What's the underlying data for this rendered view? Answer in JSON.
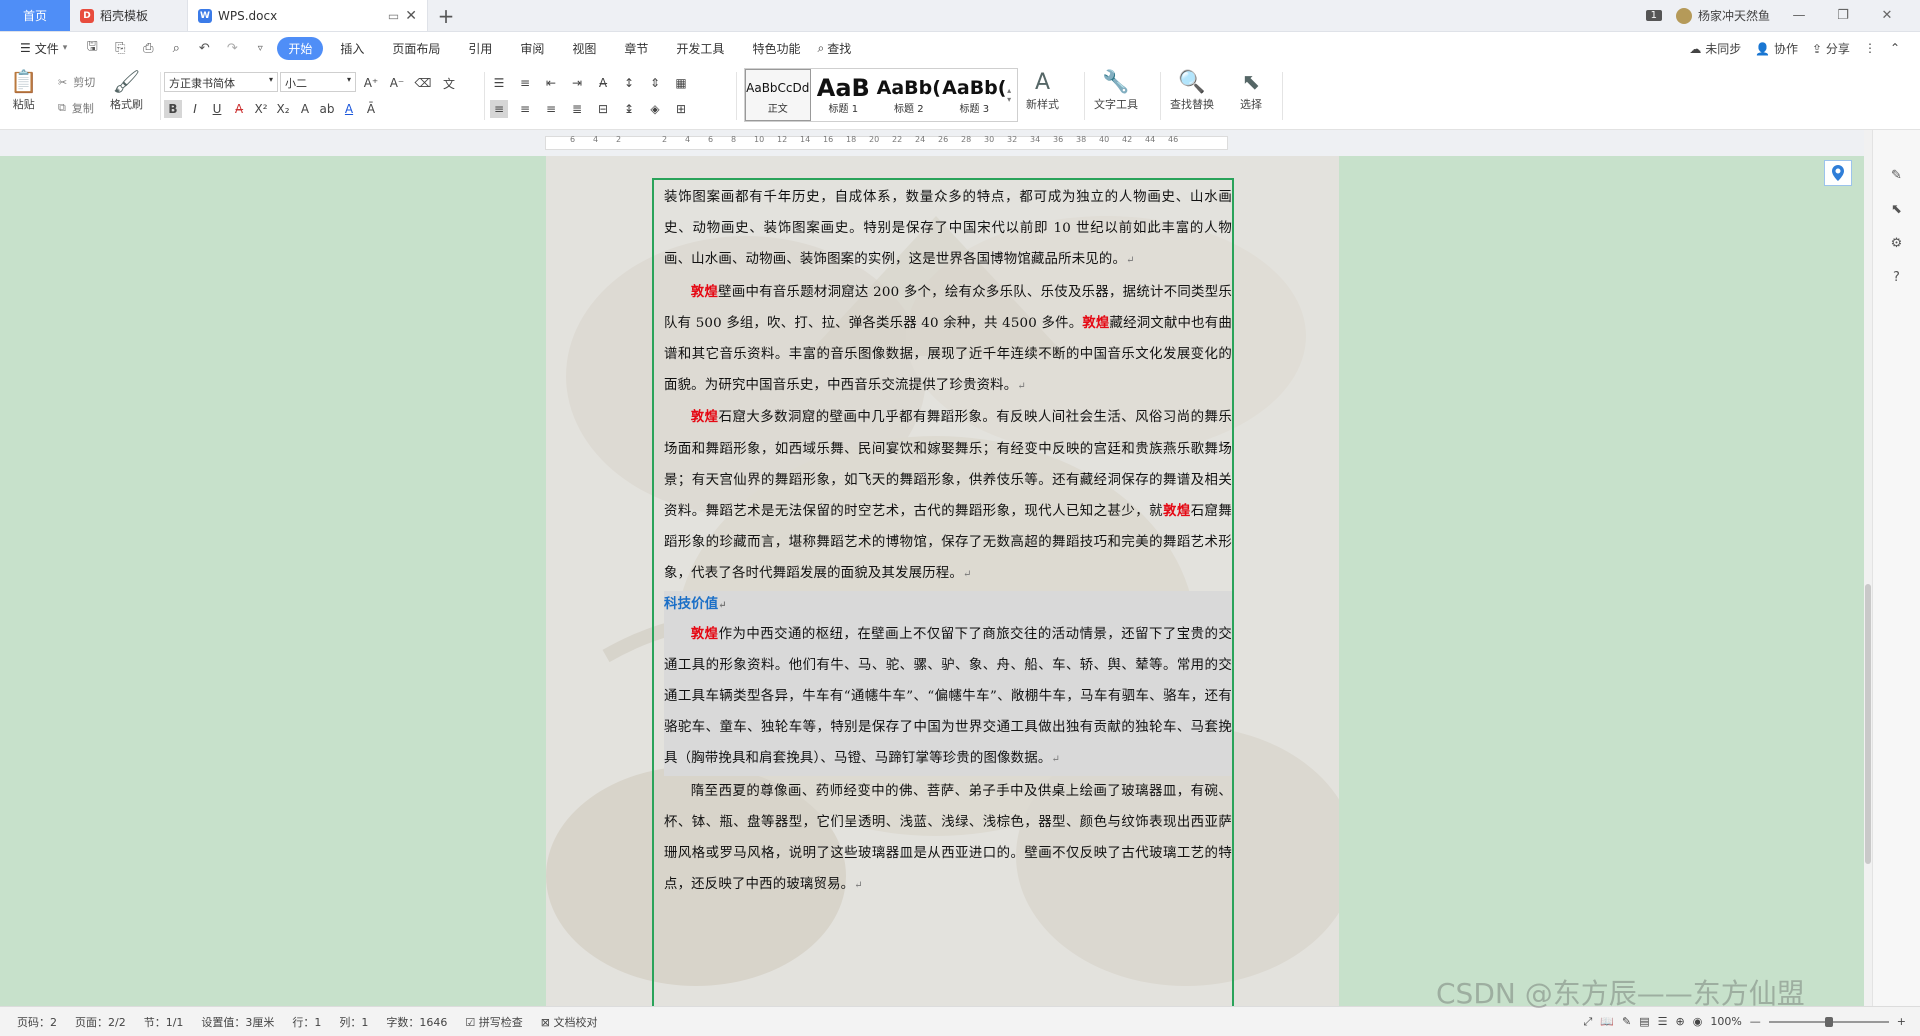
{
  "titlebar": {
    "home_tab": "首页",
    "template_tab": "稻壳模板",
    "doc_tab": "WPS.docx",
    "badge": "1",
    "user": "杨家冲天然鱼"
  },
  "menubar": {
    "file": "文件",
    "tabs": [
      "开始",
      "插入",
      "页面布局",
      "引用",
      "审阅",
      "视图",
      "章节",
      "开发工具",
      "特色功能"
    ],
    "search": "查找",
    "sync": "未同步",
    "collab": "协作",
    "share": "分享"
  },
  "ribbon": {
    "paste": "粘贴",
    "cut": "剪切",
    "copy": "复制",
    "format_painter": "格式刷",
    "font_name": "方正隶书简体",
    "font_size": "小二",
    "styles": [
      {
        "sample": "AaBbCcDd",
        "label": "正文"
      },
      {
        "sample": "AaB",
        "label": "标题 1"
      },
      {
        "sample": "AaBb(",
        "label": "标题 2"
      },
      {
        "sample": "AaBb(",
        "label": "标题 3"
      }
    ],
    "new_style": "新样式",
    "text_tools": "文字工具",
    "find_replace": "查找替换",
    "select": "选择"
  },
  "ruler": {
    "numbers": [
      "6",
      "4",
      "2",
      "",
      "2",
      "4",
      "6",
      "8",
      "10",
      "12",
      "14",
      "16",
      "18",
      "20",
      "22",
      "24",
      "26",
      "28",
      "30",
      "32",
      "34",
      "36",
      "38",
      "40",
      "42",
      "44",
      "46"
    ]
  },
  "document": {
    "p1": "装饰图案画都有千年历史，自成体系，数量众多的特点，都可成为独立的人物画史、山水画史、动物画史、装饰图案画史。特别是保存了中国宋代以前即 10 世纪以前如此丰富的人物画、山水画、动物画、装饰图案的实例，这是世界各国博物馆藏品所未见的。",
    "kw": "敦煌",
    "p2a": "壁画中有音乐题材洞窟达 200 多个，绘有众多乐队、乐伎及乐器，据统计不同类型乐队有 500 多组，吹、打、拉、弹各类乐器 40 余种，共 4500 多件。",
    "p2b": "藏经洞文献中也有曲谱和其它音乐资料。丰富的音乐图像数据，展现了近千年连续不断的中国音乐文化发展变化的面貌。为研究中国音乐史，中西音乐交流提供了珍贵资料。",
    "p3a": "石窟大多数洞窟的壁画中几乎都有舞蹈形象。有反映人间社会生活、风俗习尚的舞乐场面和舞蹈形象，如西域乐舞、民间宴饮和嫁娶舞乐；有经变中反映的宫廷和贵族燕乐歌舞场景；有天宫仙界的舞蹈形象，如飞天的舞蹈形象，供养伎乐等。还有藏经洞保存的舞谱及相关资料。舞蹈艺术是无法保留的时空艺术，古代的舞蹈形象，现代人已知之甚少，就",
    "p3b": "石窟舞蹈形象的珍藏而言，堪称舞蹈艺术的博物馆，保存了无数高超的舞蹈技巧和完美的舞蹈艺术形象，代表了各时代舞蹈发展的面貌及其发展历程。",
    "heading": "科技价值",
    "p4": "作为中西交通的枢纽，在壁画上不仅留下了商旅交往的活动情景，还留下了宝贵的交通工具的形象资料。他们有牛、马、驼、骡、驴、象、舟、船、车、轿、舆、辇等。常用的交通工具车辆类型各异，牛车有“通幰牛车”、“偏幰牛车”、敞棚牛车，马车有驷车、骆车，还有骆驼车、童车、独轮车等，特别是保存了中国为世界交通工具做出独有贡献的独轮车、马套挽具（胸带挽具和肩套挽具）、马镫、马蹄钉掌等珍贵的图像数据。",
    "p5": "隋至西夏的尊像画、药师经变中的佛、菩萨、弟子手中及供桌上绘画了玻璃器皿，有碗、杯、钵、瓶、盘等器型，它们呈透明、浅蓝、浅绿、浅棕色，器型、颜色与纹饰表现出西亚萨珊风格或罗马风格，说明了这些玻璃器皿是从西亚进口的。壁画不仅反映了古代玻璃工艺的特点，还反映了中西的玻璃贸易。",
    "pmark": "↵"
  },
  "statusbar": {
    "page_code": "页码：2",
    "pages": "页面：2/2",
    "section": "节：1/1",
    "setting": "设置值：3厘米",
    "row": "行：1",
    "col": "列：1",
    "words": "字数：1646",
    "spell": "拼写检查",
    "proof": "文档校对",
    "zoom": "100%"
  },
  "watermark": "CSDN @东方辰——东方仙盟",
  "colors": {
    "accent": "#4f8ef7",
    "workspace": "#c7e1cb",
    "frame": "#2aa35a",
    "keyword": "#e50914",
    "heading": "#1b6fc7"
  }
}
